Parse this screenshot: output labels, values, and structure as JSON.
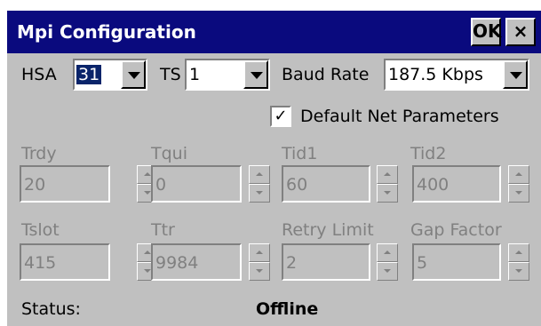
{
  "window": {
    "title": "Mpi Configuration",
    "ok_label": "OK",
    "close_label": "×"
  },
  "row1": {
    "hsa_label": "HSA",
    "hsa_value": "31",
    "ts_label": "TS",
    "ts_value": "1",
    "baud_label": "Baud Rate",
    "baud_value": "187.5 Kbps"
  },
  "checkbox": {
    "label": "Default Net Parameters",
    "checked": true,
    "mark": "✓"
  },
  "params": [
    {
      "label": "Trdy",
      "value": "20"
    },
    {
      "label": "Tqui",
      "value": "0"
    },
    {
      "label": "Tid1",
      "value": "60"
    },
    {
      "label": "Tid2",
      "value": "400"
    },
    {
      "label": "Tslot",
      "value": "415"
    },
    {
      "label": "Ttr",
      "value": "9984"
    },
    {
      "label": "Retry Limit",
      "value": "2"
    },
    {
      "label": "Gap Factor",
      "value": "5"
    }
  ],
  "status": {
    "label": "Status:",
    "value": "Offline"
  }
}
